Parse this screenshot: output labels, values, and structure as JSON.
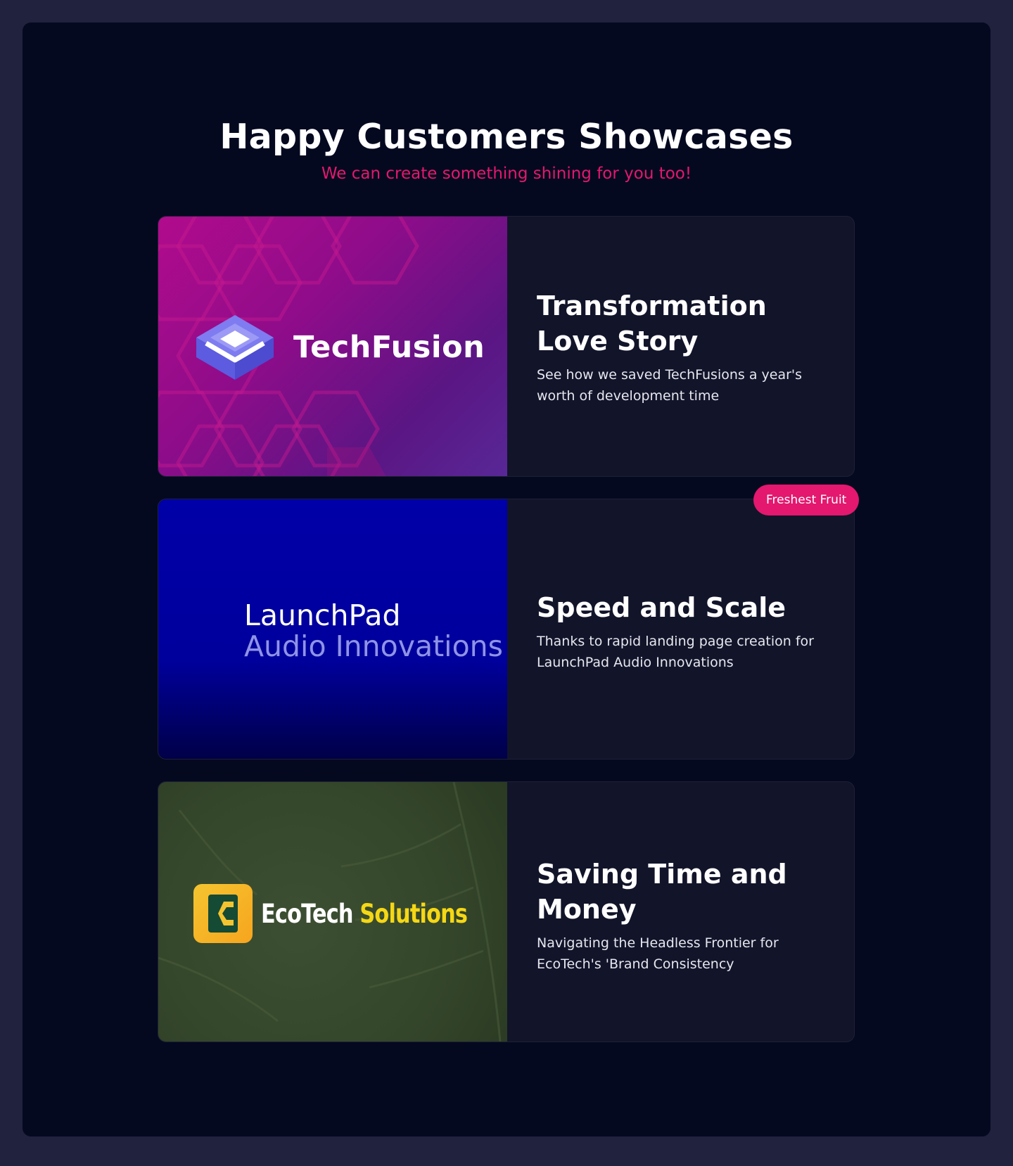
{
  "header": {
    "title": "Happy Customers Showcases",
    "subtitle": "We can create something shining for you too!"
  },
  "cards": [
    {
      "logo": {
        "name": "TechFusion",
        "icon": "stacked-layers-icon"
      },
      "title": "Transformation Love Story",
      "description": "See how we saved TechFusions a year's worth of development time"
    },
    {
      "badge": "Freshest Fruit",
      "logo": {
        "line1": "LaunchPad",
        "line2": "Audio Innovations",
        "icon": "audio-waveform-icon"
      },
      "title": "Speed and Scale",
      "description": "Thanks to rapid landing page creation for LaunchPad Audio Innovations"
    },
    {
      "logo": {
        "word1": "EcoTech",
        "word2": "Solutions",
        "icon": "ecotech-e-icon"
      },
      "title": "Saving Time and Money",
      "description": "Navigating the Headless Frontier for EcoTech's 'Brand Consistency"
    }
  ],
  "colors": {
    "page_background": "#21223d",
    "frame_background": "#050920",
    "card_background": "#12142a",
    "accent": "#e3186e",
    "ecotech_yellow": "#f5d715",
    "launchpad_blue": "#0000a8",
    "launchpad_secondary": "#8f93e6"
  }
}
